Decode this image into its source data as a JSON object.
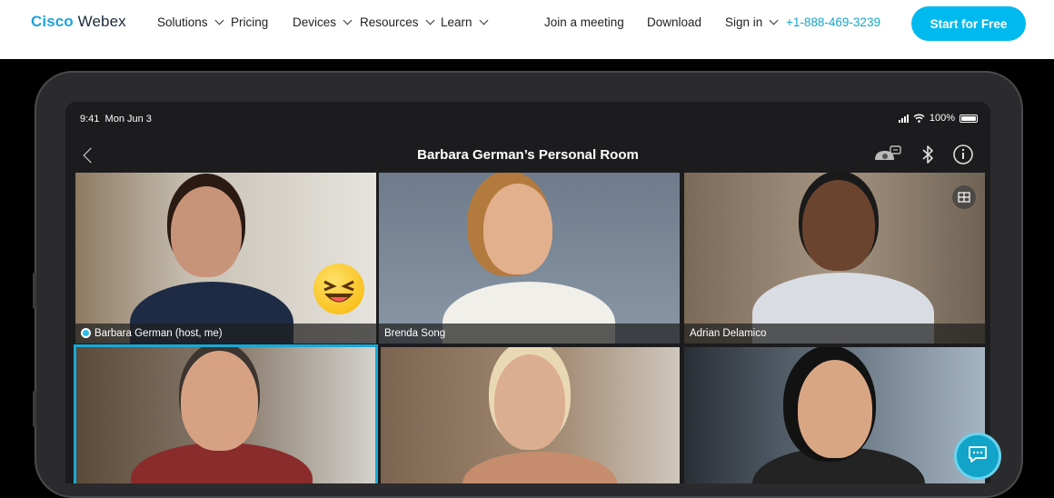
{
  "nav": {
    "logo_cisco": "Cisco",
    "logo_webex": "Webex",
    "items": [
      {
        "label": "Solutions",
        "dropdown": true
      },
      {
        "label": "Pricing",
        "dropdown": false
      },
      {
        "label": "Devices",
        "dropdown": true
      },
      {
        "label": "Resources",
        "dropdown": true
      },
      {
        "label": "Learn",
        "dropdown": true
      }
    ],
    "join": "Join a meeting",
    "download": "Download",
    "signin": "Sign in",
    "phone": "+1-888-469-3239",
    "cta": "Start for Free"
  },
  "device": {
    "time": "9:41",
    "date": "Mon Jun 3",
    "battery": "100%",
    "room_title": "Barbara German’s Personal Room"
  },
  "participants": [
    {
      "name": "Barbara German (host, me)",
      "active": false
    },
    {
      "name": "Brenda Song",
      "active": false
    },
    {
      "name": "Adrian Delamico",
      "active": false
    },
    {
      "name": "",
      "active": true
    },
    {
      "name": "",
      "active": false
    },
    {
      "name": "",
      "active": false
    }
  ],
  "colors": {
    "accent": "#00b9ee",
    "active_speaker": "#19a8d4",
    "phone": "#13a7c9"
  },
  "icons": [
    "chevron-down-icon",
    "back-chevron-icon",
    "proximity-icon",
    "bluetooth-icon",
    "info-icon",
    "grid-layout-icon",
    "chat-icon",
    "emoji-laugh-icon"
  ]
}
